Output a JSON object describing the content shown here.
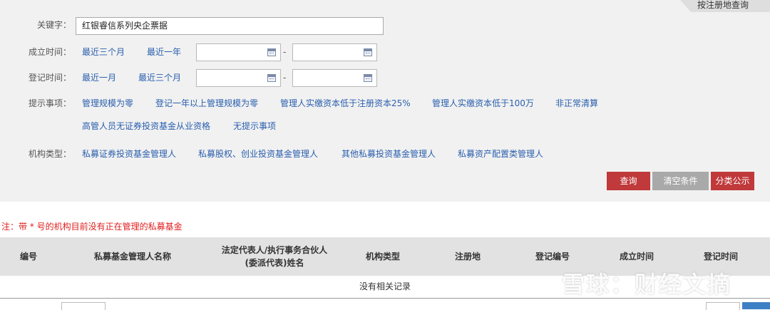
{
  "corner_tab": "按注册地查询",
  "keyword": {
    "label": "关键字：",
    "value": "红银睿信系列央企票据"
  },
  "established": {
    "label": "成立时间：",
    "links": [
      "最近三个月",
      "最近一年"
    ],
    "dash": "-"
  },
  "registered": {
    "label": "登记时间：",
    "links": [
      "最近一月",
      "最近三个月"
    ],
    "dash": "-"
  },
  "tips": {
    "label": "提示事项：",
    "links": [
      "管理规模为零",
      "登记一年以上管理规模为零",
      "管理人实缴资本低于注册资本25%",
      "管理人实缴资本低于100万",
      "非正常清算",
      "高管人员无证券投资基金从业资格",
      "无提示事项"
    ]
  },
  "org_type": {
    "label": "机构类型：",
    "links": [
      "私募证券投资基金管理人",
      "私募股权、创业投资基金管理人",
      "其他私募投资基金管理人",
      "私募资产配置类管理人"
    ]
  },
  "buttons": {
    "query": "查询",
    "clear": "清空条件",
    "classified": "分类公示"
  },
  "note": "注：带 * 号的机构目前没有正在管理的私募基金",
  "table": {
    "headers": [
      "编号",
      "私募基金管理人名称",
      "法定代表人/执行事务合伙人",
      "(委派代表)姓名",
      "机构类型",
      "注册地",
      "登记编号",
      "成立时间",
      "登记时间"
    ],
    "empty": "没有相关记录"
  },
  "watermark": "雪球：财经文摘",
  "colors": {
    "link": "#2a5fae",
    "query_btn": "#c0393b",
    "clear_btn": "#a9a9a9",
    "classified_btn": "#c0393b",
    "note": "#e02020",
    "pager_btn": "#3d7fc4"
  }
}
